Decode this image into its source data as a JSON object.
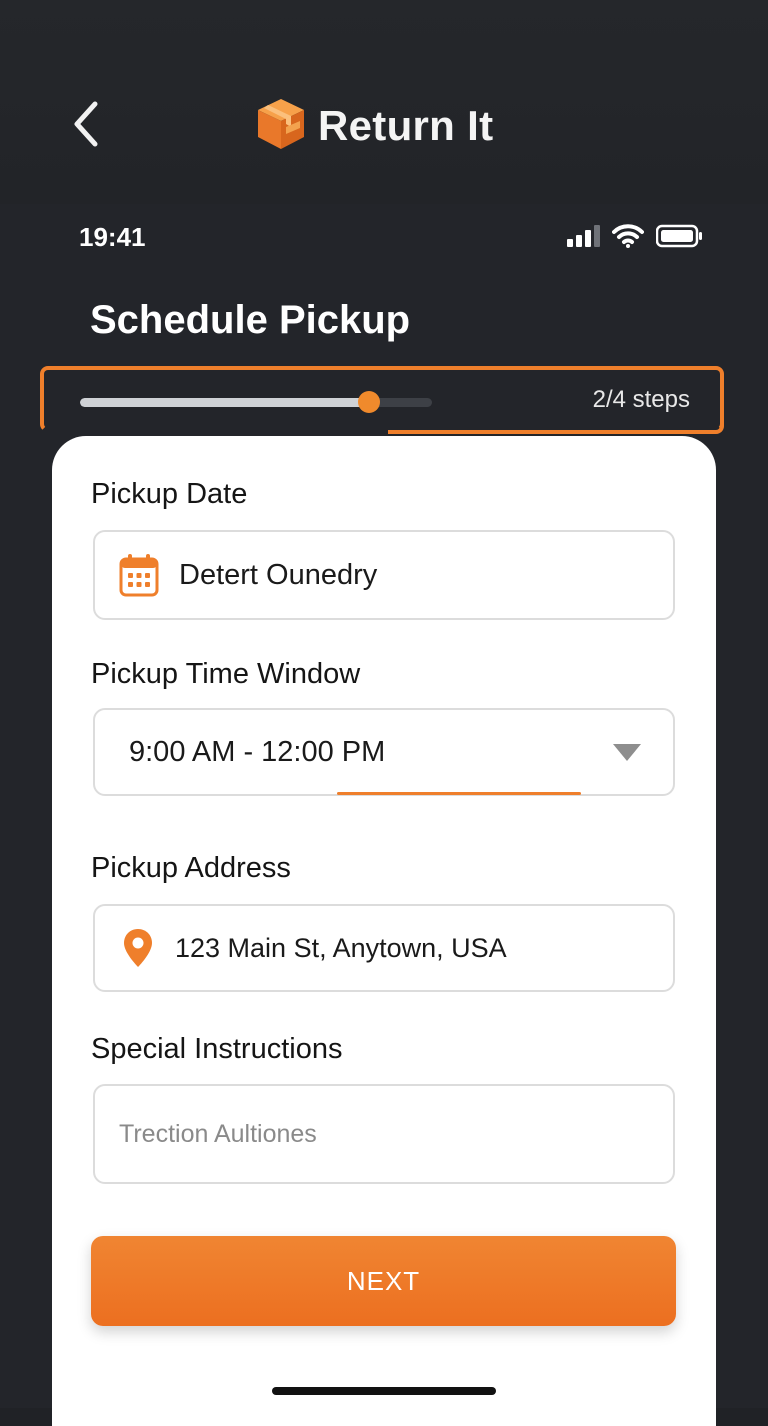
{
  "header": {
    "back_icon": "chevron-left-icon",
    "brand_icon": "package-box-icon",
    "app_title": "Return It"
  },
  "status_bar": {
    "time": "19:41",
    "icons": [
      "cellular-signal-icon",
      "wifi-icon",
      "battery-icon"
    ]
  },
  "page": {
    "title": "Schedule Pickup"
  },
  "progress": {
    "label": "2/4 steps",
    "fraction": 0.82
  },
  "form": {
    "pickup_date": {
      "label": "Pickup Date",
      "value": "Detert Ounedry",
      "icon": "calendar-icon"
    },
    "time_window": {
      "label": "Pickup Time Window",
      "value": "9:00 AM - 12:00 PM",
      "icon": "dropdown-triangle-icon"
    },
    "address": {
      "label": "Pickup Address",
      "value": "123 Main St, Anytown, USA",
      "icon": "location-pin-icon"
    },
    "instructions": {
      "label": "Special Instructions",
      "placeholder": "Trection Aultiones"
    },
    "next_label": "NEXT"
  },
  "colors": {
    "accent": "#ef7f2b",
    "background": "#23252a",
    "card": "#ffffff"
  }
}
